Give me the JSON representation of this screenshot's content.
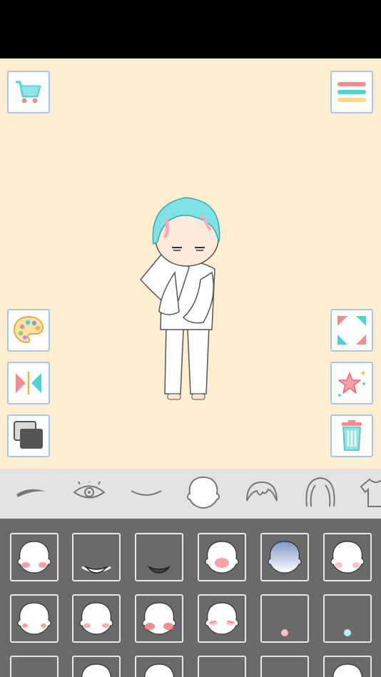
{
  "app": {
    "colors": {
      "canvas_bg": "#ffeed2",
      "button_border": "#a9c6ea",
      "category_bar_bg": "#e3e3e3",
      "grid_bg": "#6a6a6a",
      "tile_border": "#e8e8e8",
      "accent_teal": "#4fd1d6",
      "accent_pink": "#f58a8f",
      "accent_yellow": "#f9d98a"
    }
  },
  "canvas": {
    "left_tools": [
      {
        "name": "shop-cart-icon"
      },
      {
        "name": "color-palette-icon"
      },
      {
        "name": "flip-horizontal-icon"
      },
      {
        "name": "layers-icon"
      }
    ],
    "right_tools": [
      {
        "name": "menu-icon"
      },
      {
        "name": "fullscreen-icon"
      },
      {
        "name": "favorite-star-icon"
      },
      {
        "name": "trash-icon"
      }
    ],
    "character": {
      "hair_color": "#7fe3e6",
      "hair_streak_color": "#f7a9b7",
      "outfit_color": "#ffffff"
    }
  },
  "categories": {
    "selected_index": 3,
    "items": [
      {
        "icon": "eyebrow-icon"
      },
      {
        "icon": "eye-icon"
      },
      {
        "icon": "mouth-icon"
      },
      {
        "icon": "face-shape-icon"
      },
      {
        "icon": "front-hair-icon"
      },
      {
        "icon": "back-hair-icon"
      },
      {
        "icon": "clothing-icon"
      }
    ]
  },
  "options": {
    "rows": [
      [
        "face-blush-cheeks",
        "mouth-overlay-white",
        "mouth-overlay-dark",
        "face-blush-center",
        "face-blue-shade",
        "face-blush-light"
      ],
      [
        "face-blush-small",
        "face-blush-soft",
        "face-blush-strong",
        "face-blush-lines",
        "dot-pink",
        "dot-blue"
      ],
      [
        "partial-1",
        "partial-2",
        "partial-3",
        "partial-4",
        "partial-5",
        "partial-6"
      ]
    ]
  }
}
